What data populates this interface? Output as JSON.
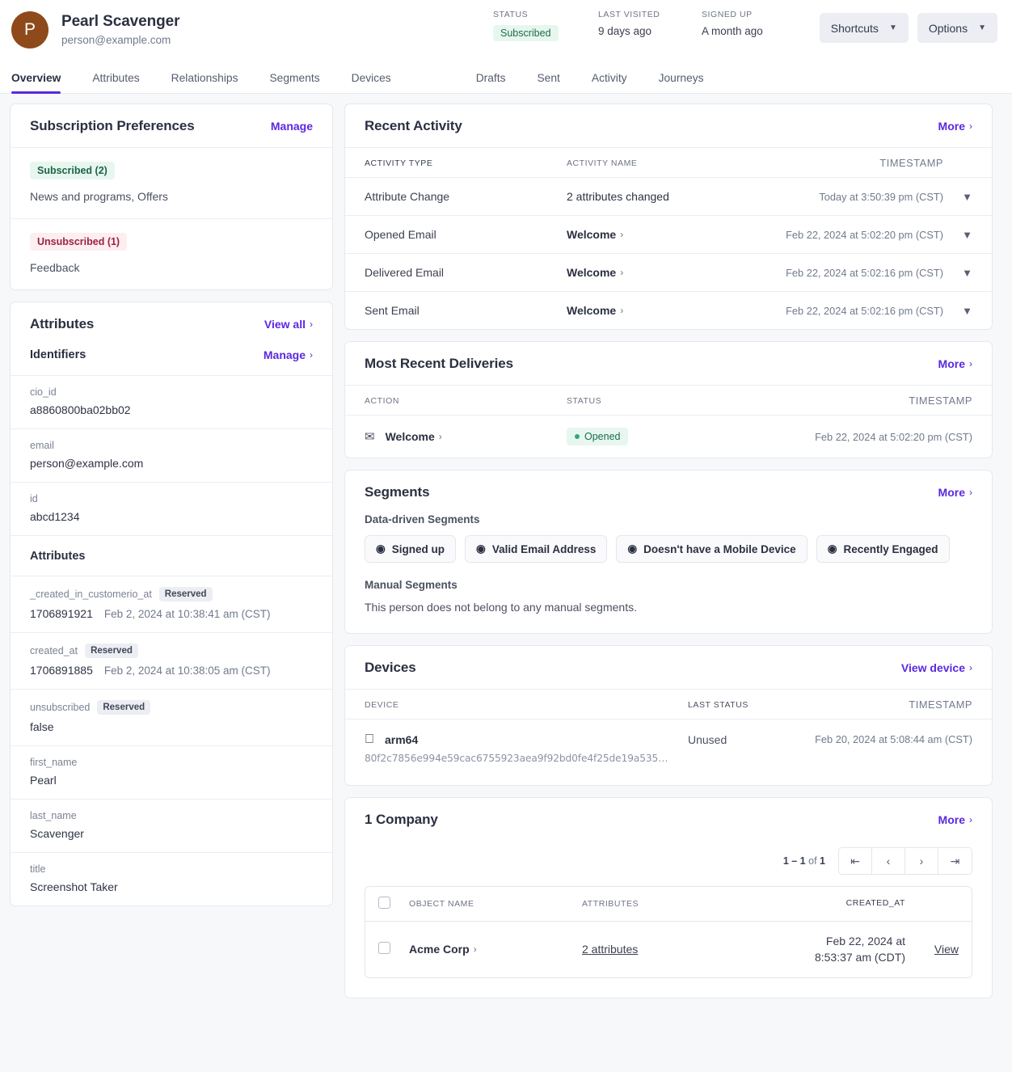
{
  "header": {
    "avatar_initial": "P",
    "name": "Pearl Scavenger",
    "email": "person@example.com",
    "meta": [
      {
        "label": "STATUS",
        "value": "Subscribed",
        "type": "badge"
      },
      {
        "label": "LAST VISITED",
        "value": "9 days ago",
        "type": "text"
      },
      {
        "label": "SIGNED UP",
        "value": "A month ago",
        "type": "text"
      }
    ],
    "buttons": [
      {
        "label": "Shortcuts",
        "icon": "chevron-down-icon"
      },
      {
        "label": "Options",
        "icon": "chevron-down-icon"
      }
    ]
  },
  "tabs": {
    "primary": [
      "Overview",
      "Attributes",
      "Relationships",
      "Segments",
      "Devices"
    ],
    "secondary": [
      "Drafts",
      "Sent",
      "Activity",
      "Journeys"
    ],
    "active": "Overview"
  },
  "subscription_preferences": {
    "title": "Subscription Preferences",
    "action": "Manage",
    "groups": [
      {
        "badge": "Subscribed (2)",
        "tone": "green",
        "values": "News and programs, Offers"
      },
      {
        "badge": "Unsubscribed (1)",
        "tone": "pink",
        "values": "Feedback"
      }
    ]
  },
  "attributes_card": {
    "title": "Attributes",
    "view_all": "View all",
    "identifiers_title": "Identifiers",
    "identifiers_action": "Manage",
    "identifiers": [
      {
        "key": "cio_id",
        "value": "a8860800ba02bb02"
      },
      {
        "key": "email",
        "value": "person@example.com"
      },
      {
        "key": "id",
        "value": "abcd1234"
      }
    ],
    "attributes_title": "Attributes",
    "attributes": [
      {
        "key": "_created_in_customerio_at",
        "tag": "Reserved",
        "value": "1706891921",
        "extra": "Feb 2, 2024 at 10:38:41 am (CST)"
      },
      {
        "key": "created_at",
        "tag": "Reserved",
        "value": "1706891885",
        "extra": "Feb 2, 2024 at 10:38:05 am (CST)"
      },
      {
        "key": "unsubscribed",
        "tag": "Reserved",
        "value": "false",
        "extra": ""
      },
      {
        "key": "first_name",
        "tag": "",
        "value": "Pearl",
        "extra": ""
      },
      {
        "key": "last_name",
        "tag": "",
        "value": "Scavenger",
        "extra": ""
      },
      {
        "key": "title",
        "tag": "",
        "value": "Screenshot Taker",
        "extra": ""
      }
    ]
  },
  "recent_activity": {
    "title": "Recent Activity",
    "more": "More",
    "columns": [
      "ACTIVITY TYPE",
      "ACTIVITY NAME",
      "TIMESTAMP"
    ],
    "rows": [
      {
        "type": "Attribute Change",
        "name": "2 attributes changed",
        "name_is_link": false,
        "timestamp": "Today at 3:50:39 pm (CST)"
      },
      {
        "type": "Opened Email",
        "name": "Welcome",
        "name_is_link": true,
        "timestamp": "Feb 22, 2024 at 5:02:20 pm (CST)"
      },
      {
        "type": "Delivered Email",
        "name": "Welcome",
        "name_is_link": true,
        "timestamp": "Feb 22, 2024 at 5:02:16 pm (CST)"
      },
      {
        "type": "Sent Email",
        "name": "Welcome",
        "name_is_link": true,
        "timestamp": "Feb 22, 2024 at 5:02:16 pm (CST)"
      }
    ]
  },
  "most_recent_deliveries": {
    "title": "Most Recent Deliveries",
    "more": "More",
    "columns": [
      "ACTION",
      "STATUS",
      "TIMESTAMP"
    ],
    "rows": [
      {
        "action": "Welcome",
        "status": "Opened",
        "timestamp": "Feb 22, 2024 at 5:02:20 pm (CST)"
      }
    ]
  },
  "segments": {
    "title": "Segments",
    "more": "More",
    "data_driven_label": "Data-driven Segments",
    "chips": [
      "Signed up",
      "Valid Email Address",
      "Doesn't have a Mobile Device",
      "Recently Engaged"
    ],
    "manual_label": "Manual Segments",
    "manual_note": "This person does not belong to any manual segments."
  },
  "devices": {
    "title": "Devices",
    "action": "View device",
    "columns": [
      "DEVICE",
      "LAST STATUS",
      "TIMESTAMP"
    ],
    "rows": [
      {
        "platform_icon": "apple-icon",
        "name": "arm64",
        "token": "80f2c7856e994e59cac6755923aea9f92bd0fe4f25de19a535…",
        "last_status": "Unused",
        "timestamp": "Feb 20, 2024 at 5:08:44 am (CST)"
      }
    ]
  },
  "company": {
    "title": "1 Company",
    "more": "More",
    "pagination": {
      "range": "1 – 1",
      "of": "of",
      "total": "1"
    },
    "columns": [
      "OBJECT NAME",
      "ATTRIBUTES",
      "CREATED_AT"
    ],
    "rows": [
      {
        "name": "Acme Corp",
        "attributes": "2 attributes",
        "created_at": "Feb 22, 2024 at 8:53:37 am (CDT)",
        "view": "View"
      }
    ]
  },
  "colors": {
    "accent": "#5b28e0",
    "avatar_bg": "#8e4a1b",
    "green_badge_bg": "#e7f7ef",
    "green_badge_fg": "#1d6b4b",
    "pink_badge_bg": "#fdeef1",
    "pink_badge_fg": "#9c2141",
    "page_bg": "#f7f8fa"
  }
}
